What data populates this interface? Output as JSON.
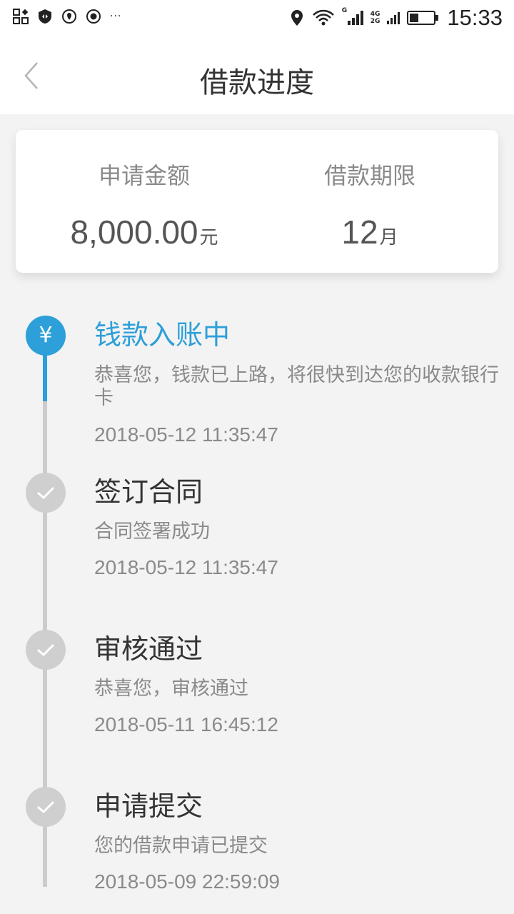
{
  "status_bar": {
    "time": "15:33",
    "net_top": "4G",
    "net_bottom": "2G",
    "signal_badge": "G",
    "icons": [
      "qr-scan-icon",
      "shield-icon",
      "location-pin-icon",
      "record-icon",
      "more-dots-icon",
      "location-icon",
      "wifi-icon",
      "signal-icon",
      "battery-icon"
    ],
    "dots": "···"
  },
  "header": {
    "title": "借款进度"
  },
  "summary": {
    "amount_label": "申请金额",
    "amount_value": "8,000.00",
    "amount_unit": "元",
    "term_label": "借款期限",
    "term_value": "12",
    "term_unit": "月"
  },
  "timeline": {
    "steps": [
      {
        "title": "钱款入账中",
        "desc": "恭喜您，钱款已上路，将很快到达您的收款银行卡",
        "time": "2018-05-12 11:35:47",
        "status": "active",
        "icon": "yen-icon",
        "icon_text": "¥"
      },
      {
        "title": "签订合同",
        "desc": "合同签署成功",
        "time": "2018-05-12 11:35:47",
        "status": "done",
        "icon": "check-icon"
      },
      {
        "title": "审核通过",
        "desc": "恭喜您，审核通过",
        "time": "2018-05-11 16:45:12",
        "status": "done",
        "icon": "check-icon"
      },
      {
        "title": "申请提交",
        "desc": "您的借款申请已提交",
        "time": "2018-05-09 22:59:09",
        "status": "done",
        "icon": "check-icon"
      }
    ]
  },
  "colors": {
    "accent": "#2d9fd9",
    "inactive": "#cccccc",
    "text_primary": "#333333",
    "text_secondary": "#8a8a8a",
    "background": "#f3f3f3"
  }
}
